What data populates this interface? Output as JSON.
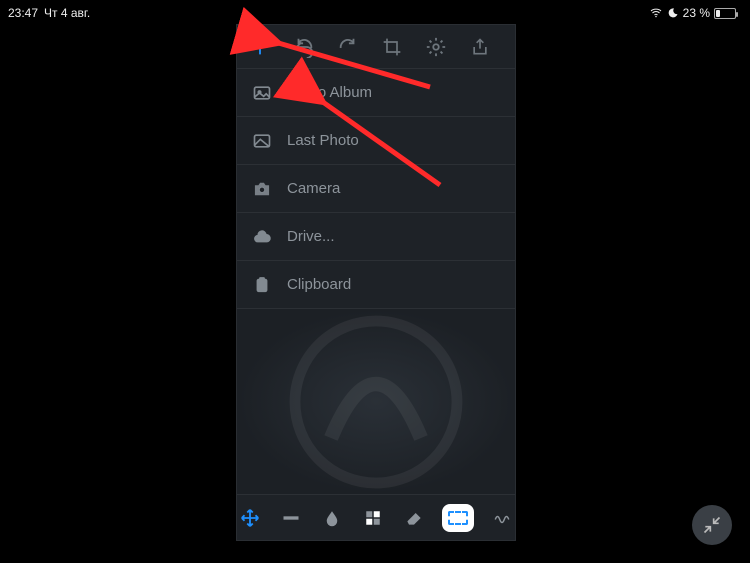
{
  "status_bar": {
    "time": "23:47",
    "date": "Чт 4 авг.",
    "battery_text": "23 %"
  },
  "top_toolbar": {
    "add": "add",
    "undo": "undo",
    "redo": "redo",
    "crop": "crop",
    "settings": "settings",
    "share": "share"
  },
  "menu": {
    "items": [
      {
        "label": "Photo Album",
        "icon": "photo"
      },
      {
        "label": "Last Photo",
        "icon": "image"
      },
      {
        "label": "Camera",
        "icon": "camera"
      },
      {
        "label": "Drive...",
        "icon": "cloud"
      },
      {
        "label": "Clipboard",
        "icon": "clipboard"
      }
    ]
  },
  "bottom_toolbar": {
    "tools": [
      "move",
      "line",
      "blur",
      "blocks",
      "eraser",
      "select",
      "scribble"
    ]
  }
}
